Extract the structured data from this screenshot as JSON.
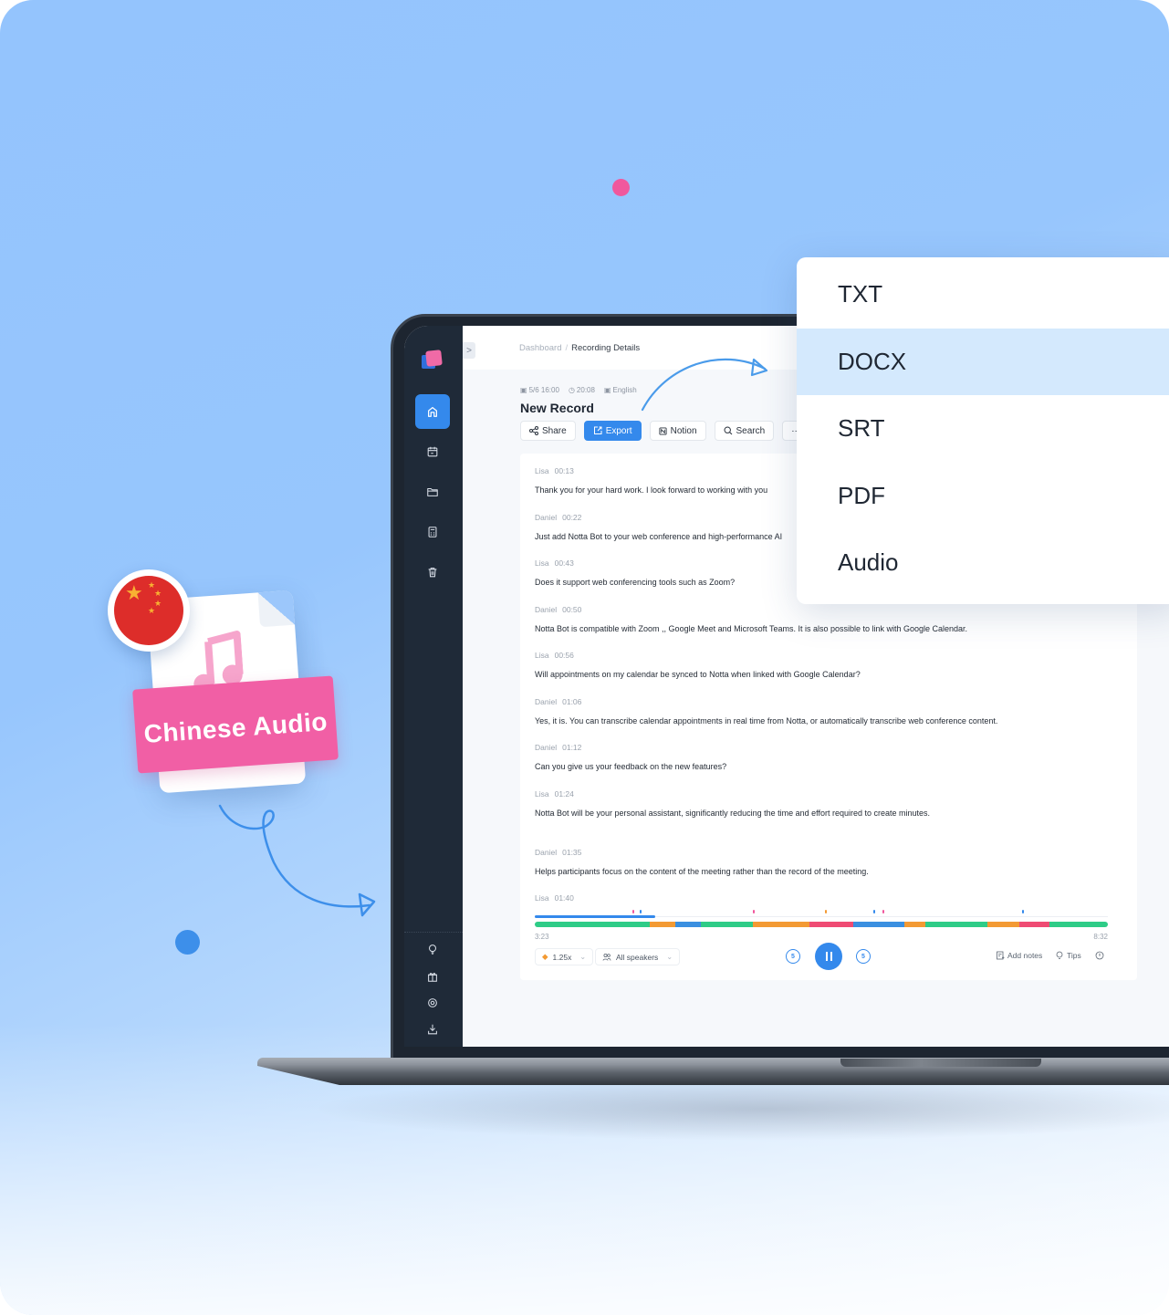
{
  "promo": {
    "file_label": "Chinese Audio",
    "flag": "china-flag",
    "file_icon": "music-note-icon"
  },
  "app": {
    "breadcrumb": {
      "parent": "Dashboard",
      "separator": "/",
      "current": "Recording Details"
    },
    "sidebar": {
      "top_items": [
        {
          "name": "home",
          "icon": "home-icon",
          "active": true
        },
        {
          "name": "calendar",
          "icon": "calendar-icon",
          "active": false
        },
        {
          "name": "folder",
          "icon": "folder-icon",
          "active": false
        },
        {
          "name": "calculator",
          "icon": "document-icon",
          "active": false
        },
        {
          "name": "trash",
          "icon": "trash-icon",
          "active": false
        }
      ],
      "bottom_items": [
        {
          "name": "tips",
          "icon": "lightbulb-icon"
        },
        {
          "name": "gift",
          "icon": "gift-icon"
        },
        {
          "name": "settings",
          "icon": "gear-icon"
        },
        {
          "name": "download",
          "icon": "download-icon"
        }
      ],
      "collapse_glyph": ">"
    },
    "record": {
      "date": "5/6 16:00",
      "duration": "20:08",
      "language": "English",
      "title": "New Record"
    },
    "toolbar": {
      "share": "Share",
      "export": "Export",
      "notion": "Notion",
      "search": "Search",
      "more": "···"
    },
    "transcript": [
      {
        "speaker": "Lisa",
        "time": "00:13",
        "text": "Thank you for your hard work. I look forward to working with you"
      },
      {
        "speaker": "Daniel",
        "time": "00:22",
        "text": "Just add Notta Bot to your web conference and high-performance AI"
      },
      {
        "speaker": "Lisa",
        "time": "00:43",
        "text": "Does it support web conferencing tools such as Zoom?"
      },
      {
        "speaker": "Daniel",
        "time": "00:50",
        "text": "Notta Bot is compatible with Zoom ,, Google Meet and Microsoft Teams. It is also possible to link with Google Calendar."
      },
      {
        "speaker": "Lisa",
        "time": "00:56",
        "text": "Will appointments on my calendar be synced to Notta when linked with Google Calendar?"
      },
      {
        "speaker": "Daniel",
        "time": "01:06",
        "text": "Yes, it is. You can transcribe calendar appointments in real time from Notta, or automatically transcribe web conference content."
      },
      {
        "speaker": "Daniel",
        "time": "01:12",
        "text": "Can you give us your feedback on the new features?"
      },
      {
        "speaker": "Lisa",
        "time": "01:24",
        "text": "Notta Bot will be your personal assistant, significantly reducing the time and effort required to create minutes."
      },
      {
        "speaker": "Daniel",
        "time": "01:35",
        "text": "Helps participants focus on the content of the meeting rather than the record of the meeting."
      },
      {
        "speaker": "Lisa",
        "time": "01:40",
        "text": ""
      }
    ],
    "player": {
      "current_time": "3:23",
      "total_time": "8:32",
      "progress": 0.21,
      "speed": "1.25x",
      "speakers_filter": "All speakers",
      "skip_back_seconds": "5",
      "skip_forward_seconds": "5",
      "add_notes": "Add notes",
      "tips": "Tips",
      "timeline_segments": [
        {
          "start": 0.0,
          "end": 0.2,
          "color": "#2ecc87"
        },
        {
          "start": 0.2,
          "end": 0.245,
          "color": "#f39a33"
        },
        {
          "start": 0.245,
          "end": 0.29,
          "color": "#3a8fe0"
        },
        {
          "start": 0.29,
          "end": 0.38,
          "color": "#2ecc87"
        },
        {
          "start": 0.38,
          "end": 0.48,
          "color": "#f39a33"
        },
        {
          "start": 0.48,
          "end": 0.555,
          "color": "#ef4b73"
        },
        {
          "start": 0.555,
          "end": 0.645,
          "color": "#3a8fe0"
        },
        {
          "start": 0.645,
          "end": 0.682,
          "color": "#f39a33"
        },
        {
          "start": 0.682,
          "end": 0.79,
          "color": "#2ecc87"
        },
        {
          "start": 0.79,
          "end": 0.845,
          "color": "#f39a33"
        },
        {
          "start": 0.845,
          "end": 0.898,
          "color": "#ef4b73"
        },
        {
          "start": 0.898,
          "end": 1.0,
          "color": "#2ecc87"
        }
      ],
      "markers": [
        {
          "pos": 0.171,
          "color": "#f0589d"
        },
        {
          "pos": 0.183,
          "color": "#3489ec"
        },
        {
          "pos": 0.38,
          "color": "#f0589d"
        },
        {
          "pos": 0.506,
          "color": "#f39a33"
        },
        {
          "pos": 0.59,
          "color": "#3489ec"
        },
        {
          "pos": 0.607,
          "color": "#f0589d"
        },
        {
          "pos": 0.85,
          "color": "#3489ec"
        }
      ]
    }
  },
  "export_menu": {
    "options": [
      {
        "label": "TXT",
        "selected": false
      },
      {
        "label": "DOCX",
        "selected": true
      },
      {
        "label": "SRT",
        "selected": false
      },
      {
        "label": "PDF",
        "selected": false
      },
      {
        "label": "Audio",
        "selected": false
      }
    ]
  },
  "colors": {
    "accent": "#3489ec",
    "sidebar": "#1f2a38",
    "banner": "#f15fa5",
    "menu_selected": "#d4e9fd"
  }
}
